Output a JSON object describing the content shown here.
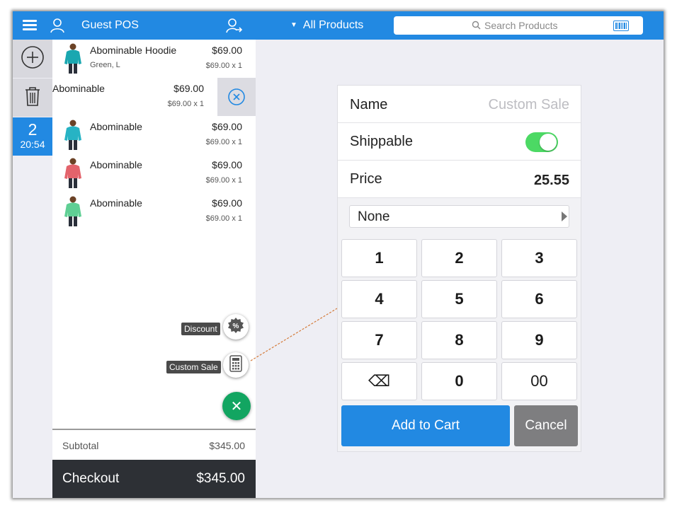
{
  "header": {
    "title": "Guest POS",
    "products_filter": "All Products",
    "search_placeholder": "Search Products",
    "icons": [
      "menu-icon",
      "user-icon",
      "switch-user-icon",
      "search-icon",
      "barcode-icon"
    ],
    "accent_color": "#2289e2"
  },
  "rail": {
    "order_number": "2",
    "order_time": "20:54"
  },
  "cart": {
    "items": [
      {
        "name": "Abominable Hoodie",
        "variant": "Green, L",
        "price": "$69.00",
        "qty": "$69.00 x 1",
        "shirt_color": "#1aa7b0"
      },
      {
        "name": "Abominable",
        "variant": "",
        "price": "$69.00",
        "qty": "$69.00 x 1",
        "shirt_color": "#1aa7b0"
      },
      {
        "name": "Abominable",
        "variant": "",
        "price": "$69.00",
        "qty": "$69.00 x 1",
        "shirt_color": "#27b3c4"
      },
      {
        "name": "Abominable",
        "variant": "",
        "price": "$69.00",
        "qty": "$69.00 x 1",
        "shirt_color": "#e3636b"
      },
      {
        "name": "Abominable",
        "variant": "",
        "price": "$69.00",
        "qty": "$69.00 x 1",
        "shirt_color": "#5fcf94"
      }
    ],
    "subtotal_label": "Subtotal",
    "subtotal_value": "$345.00",
    "checkout_label": "Checkout",
    "checkout_value": "$345.00"
  },
  "fab": {
    "discount_label": "Discount",
    "custom_sale_label": "Custom Sale",
    "close_symbol": "✕",
    "close_color": "#12a561"
  },
  "custom_sale": {
    "name_label": "Name",
    "name_placeholder": "Custom Sale",
    "shippable_label": "Shippable",
    "shippable_on": true,
    "price_label": "Price",
    "price_value": "25.55",
    "tax_value": "None",
    "keys": [
      "1",
      "2",
      "3",
      "4",
      "5",
      "6",
      "7",
      "8",
      "9",
      "⌫",
      "0",
      "00"
    ],
    "add_label": "Add to Cart",
    "cancel_label": "Cancel",
    "toggle_color": "#4cd964",
    "cancel_color": "#7e7e80"
  }
}
